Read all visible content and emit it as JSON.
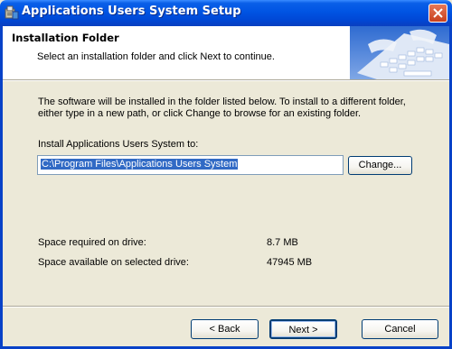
{
  "window": {
    "title": "Applications Users System Setup",
    "app_icon": "installer-icon",
    "close_icon": "close-icon"
  },
  "header": {
    "title": "Installation Folder",
    "subtitle": "Select an installation folder and click Next to continue.",
    "image": "keyboard-image"
  },
  "body": {
    "description": "The software will be installed in the folder listed below. To install to a different folder, either type in a new path, or click Change to browse for an existing folder.",
    "install_label": "Install Applications Users System to:",
    "install_path": "C:\\Program Files\\Applications Users System",
    "change_label": "Change...",
    "space_required_label": "Space required on drive:",
    "space_required_value": "8.7 MB",
    "space_available_label": "Space available on selected drive:",
    "space_available_value": "47945 MB"
  },
  "footer": {
    "back_label": "< Back",
    "next_label": "Next >",
    "cancel_label": "Cancel"
  },
  "colors": {
    "titlebar": "#0054e3",
    "dialog_bg": "#ece9d8",
    "selection": "#316ac5"
  }
}
